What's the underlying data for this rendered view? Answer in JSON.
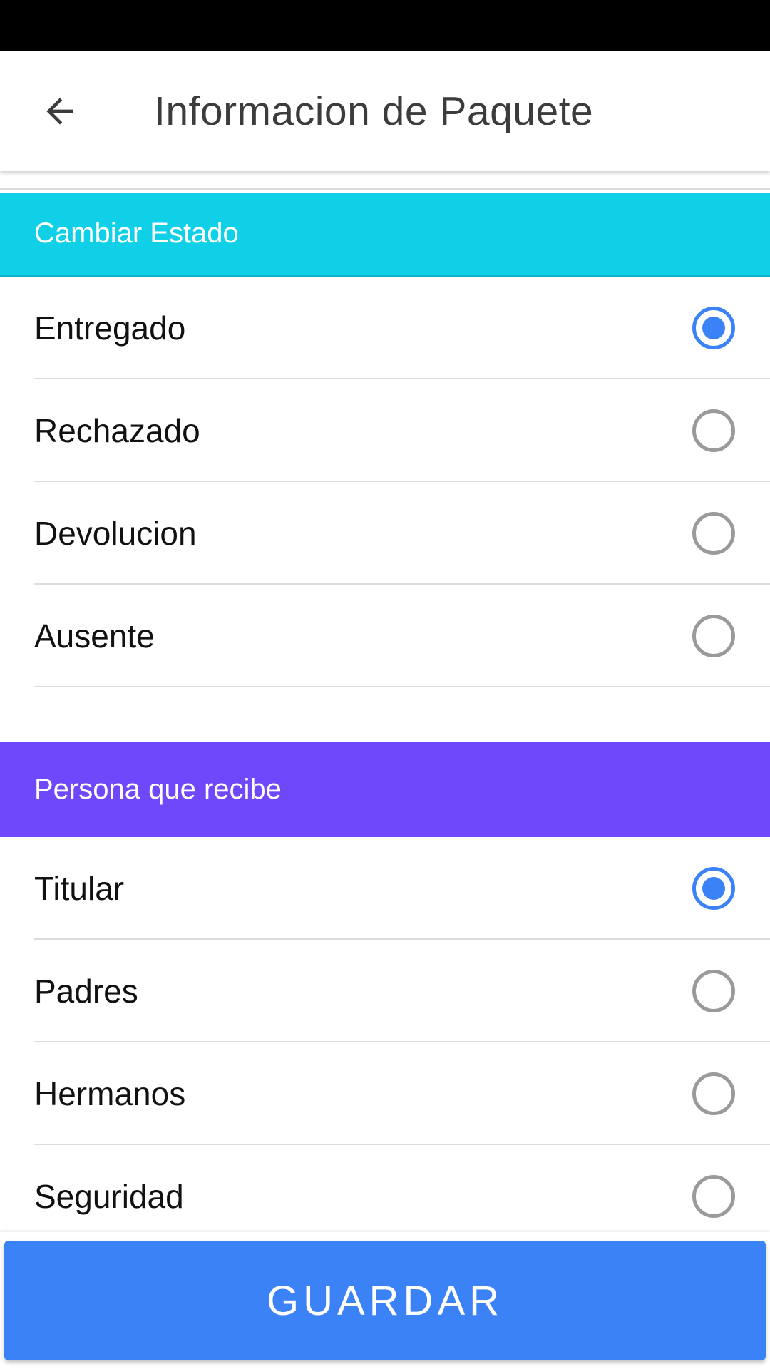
{
  "header": {
    "title": "Informacion de Paquete",
    "back_icon": "arrow-left-icon"
  },
  "colors": {
    "estado_header": "#10d0e8",
    "persona_header": "#7048fb",
    "accent": "#3b82f6"
  },
  "estado": {
    "title": "Cambiar Estado",
    "options": [
      {
        "label": "Entregado",
        "selected": true
      },
      {
        "label": "Rechazado",
        "selected": false
      },
      {
        "label": "Devolucion",
        "selected": false
      },
      {
        "label": "Ausente",
        "selected": false
      }
    ]
  },
  "persona": {
    "title": "Persona que recibe",
    "options": [
      {
        "label": "Titular",
        "selected": true
      },
      {
        "label": "Padres",
        "selected": false
      },
      {
        "label": "Hermanos",
        "selected": false
      },
      {
        "label": "Seguridad",
        "selected": false
      }
    ]
  },
  "footer": {
    "save_label": "GUARDAR"
  }
}
